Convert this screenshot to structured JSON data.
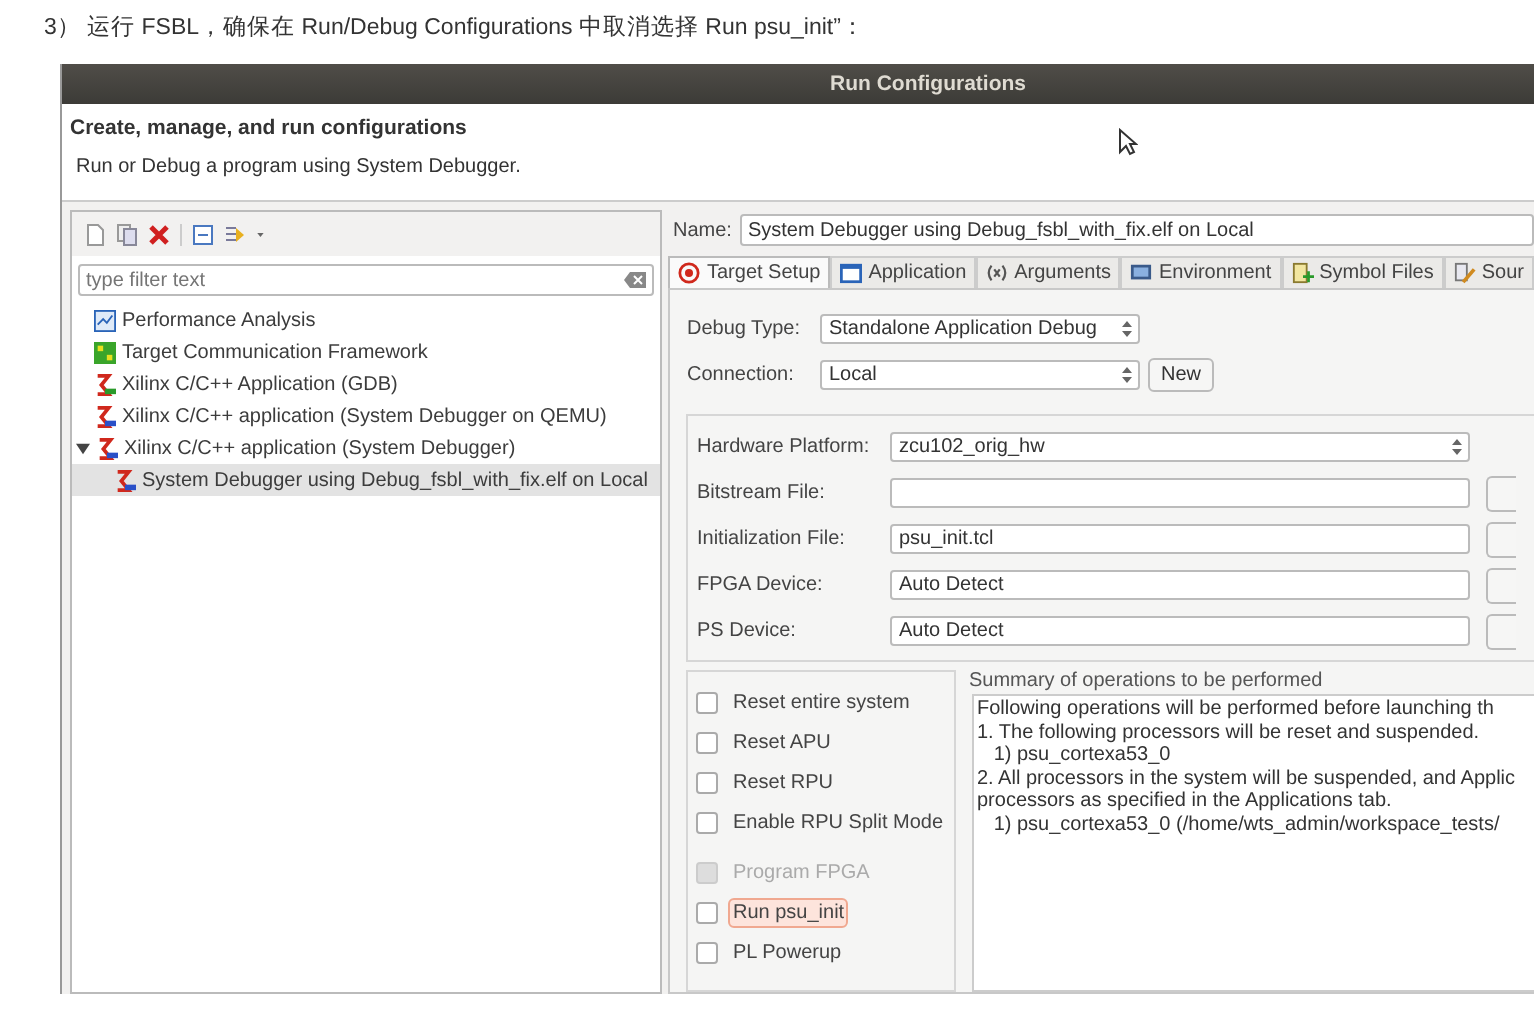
{
  "caption": "3） 运行 FSBL，确保在 Run/Debug Configurations 中取消选择 Run psu_init”：",
  "window": {
    "title": "Run Configurations"
  },
  "header": {
    "title": "Create, manage, and run configurations",
    "subtitle": "Run or Debug a program using System Debugger."
  },
  "sidebar": {
    "filter_placeholder": "type filter text",
    "tree": [
      {
        "label": "Performance Analysis",
        "kind": "perf",
        "selected": false
      },
      {
        "label": "Target Communication Framework",
        "kind": "tcf",
        "selected": false
      },
      {
        "label": "Xilinx C/C++ Application (GDB)",
        "kind": "gdb",
        "selected": false
      },
      {
        "label": "Xilinx C/C++ application (System Debugger on QEMU)",
        "kind": "xsdb",
        "selected": false
      },
      {
        "label": "Xilinx C/C++ application (System Debugger)",
        "kind": "xsdb",
        "selected": false,
        "expanded": true,
        "children": [
          {
            "label": "System Debugger using Debug_fsbl_with_fix.elf on Local",
            "kind": "xsdb",
            "selected": true
          }
        ]
      }
    ]
  },
  "config": {
    "name_label": "Name:",
    "name_value": "System Debugger using Debug_fsbl_with_fix.elf on Local",
    "tabs": [
      {
        "label": "Target Setup",
        "kind": "target",
        "selected": true
      },
      {
        "label": "Application",
        "kind": "app",
        "selected": false
      },
      {
        "label": "Arguments",
        "kind": "args",
        "selected": false
      },
      {
        "label": "Environment",
        "kind": "env",
        "selected": false
      },
      {
        "label": "Symbol Files",
        "kind": "sym",
        "selected": false
      },
      {
        "label": "Sour",
        "kind": "src",
        "selected": false
      }
    ],
    "debug_type": {
      "label": "Debug Type:",
      "value": "Standalone Application Debug"
    },
    "connection": {
      "label": "Connection:",
      "value": "Local",
      "button": "New"
    },
    "fields": [
      {
        "label": "Hardware Platform:",
        "value": "zcu102_orig_hw",
        "kind": "combo"
      },
      {
        "label": "Bitstream File:",
        "kind": "text"
      },
      {
        "label": "Initialization File:",
        "value": "psu_init.tcl",
        "kind": "text"
      },
      {
        "label": "FPGA Device:",
        "value": "Auto Detect",
        "kind": "text"
      },
      {
        "label": "PS Device:",
        "value": "Auto Detect",
        "kind": "text"
      }
    ],
    "options": [
      {
        "label": "Reset entire system",
        "checked": false,
        "disabled": false,
        "highlighted": false
      },
      {
        "label": "Reset APU",
        "checked": false,
        "disabled": false,
        "highlighted": false
      },
      {
        "label": "Reset RPU",
        "checked": false,
        "disabled": false,
        "highlighted": false
      },
      {
        "label": "Enable RPU Split Mode",
        "checked": false,
        "disabled": false,
        "highlighted": false
      },
      {
        "label": "Program FPGA",
        "checked": false,
        "disabled": true,
        "highlighted": false
      },
      {
        "label": "Run psu_init",
        "checked": false,
        "disabled": false,
        "highlighted": true
      },
      {
        "label": "PL Powerup",
        "checked": false,
        "disabled": false,
        "highlighted": false
      }
    ],
    "summary": {
      "title": "Summary of operations to be performed",
      "lines": [
        "Following operations will be performed before launching th",
        "1. The following processors will be reset and suspended.",
        "   1) psu_cortexa53_0",
        "2. All processors in the system will be suspended, and Applic",
        "processors as specified in the Applications tab.",
        "   1) psu_cortexa53_0 (/home/wts_admin/workspace_tests/"
      ]
    }
  }
}
